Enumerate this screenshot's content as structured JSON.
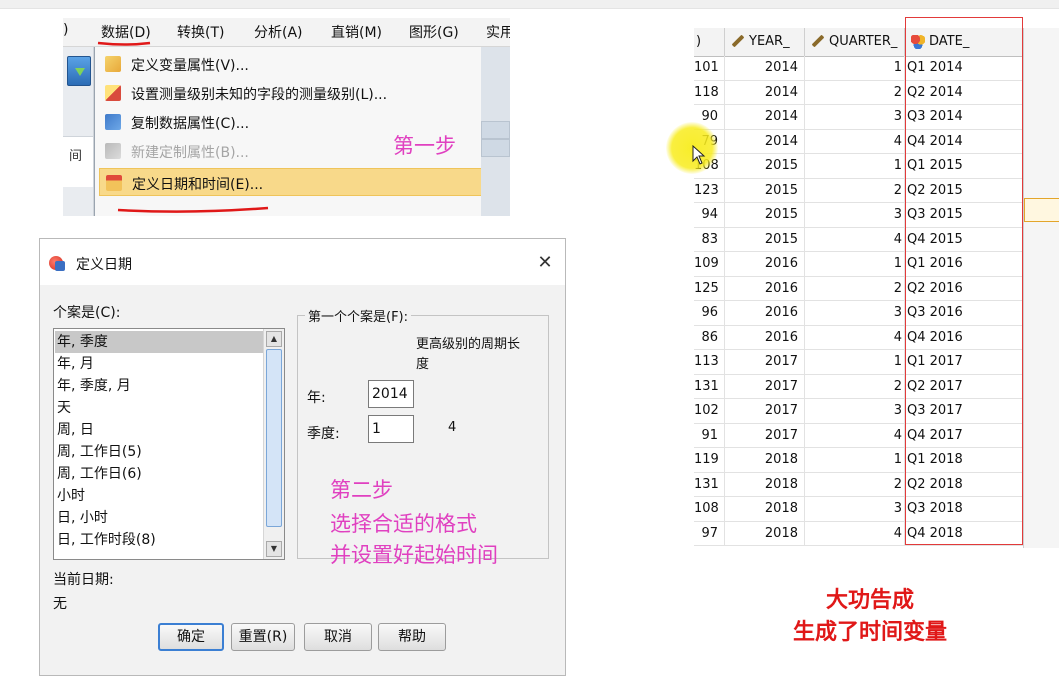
{
  "menu": {
    "items": [
      {
        "label": ")"
      },
      {
        "label": "数据(D)"
      },
      {
        "label": "转换(T)"
      },
      {
        "label": "分析(A)"
      },
      {
        "label": "直销(M)"
      },
      {
        "label": "图形(G)"
      },
      {
        "label": "实用"
      }
    ],
    "side_label": "间",
    "dropdown": [
      {
        "label": "定义变量属性(V)...",
        "icon": "define-variable-properties-icon"
      },
      {
        "label": "设置测量级别未知的字段的测量级别(L)...",
        "icon": "set-measurement-level-icon"
      },
      {
        "label": "复制数据属性(C)...",
        "icon": "copy-data-properties-icon"
      },
      {
        "label": "新建定制属性(B)...",
        "icon": "new-custom-attribute-icon"
      },
      {
        "label": "定义日期和时间(E)...",
        "icon": "define-dates-icon"
      }
    ]
  },
  "annotations": {
    "step1": "第一步",
    "step2_line1": "第二步",
    "step2_line2": "选择合适的格式",
    "step2_line3": "并设置好起始时间",
    "done_line1": "大功告成",
    "done_line2": "生成了时间变量"
  },
  "dialog": {
    "title": "定义日期",
    "close": "✕",
    "cases_label": "个案是(C):",
    "cases": [
      "年, 季度",
      "年, 月",
      "年, 季度, 月",
      "天",
      "周, 日",
      "周, 工作日(5)",
      "周, 工作日(6)",
      "小时",
      "日, 小时",
      "日, 工作时段(8)"
    ],
    "selected_case_index": 0,
    "group_title": "第一个个案是(F):",
    "periodicity_header_line1": "更高级别的周期长",
    "periodicity_header_line2": "度",
    "year_label": "年:",
    "year_value": "2014",
    "quarter_label": "季度:",
    "quarter_value": "1",
    "quarter_period": "4",
    "current_dates_label": "当前日期:",
    "current_dates_value": "无",
    "buttons": {
      "ok": "确定",
      "reset": "重置(R)",
      "cancel": "取消",
      "help": "帮助"
    }
  },
  "table": {
    "headers": {
      "first": ")",
      "year": "YEAR_",
      "quarter": "QUARTER_",
      "date": "DATE_"
    },
    "rows": [
      {
        "v": "101",
        "year": "2014",
        "q": "1",
        "date": "Q1 2014"
      },
      {
        "v": "118",
        "year": "2014",
        "q": "2",
        "date": "Q2 2014"
      },
      {
        "v": "90",
        "year": "2014",
        "q": "3",
        "date": "Q3 2014"
      },
      {
        "v": "79",
        "year": "2014",
        "q": "4",
        "date": "Q4 2014"
      },
      {
        "v": "108",
        "year": "2015",
        "q": "1",
        "date": "Q1 2015"
      },
      {
        "v": "123",
        "year": "2015",
        "q": "2",
        "date": "Q2 2015"
      },
      {
        "v": "94",
        "year": "2015",
        "q": "3",
        "date": "Q3 2015"
      },
      {
        "v": "83",
        "year": "2015",
        "q": "4",
        "date": "Q4 2015"
      },
      {
        "v": "109",
        "year": "2016",
        "q": "1",
        "date": "Q1 2016"
      },
      {
        "v": "125",
        "year": "2016",
        "q": "2",
        "date": "Q2 2016"
      },
      {
        "v": "96",
        "year": "2016",
        "q": "3",
        "date": "Q3 2016"
      },
      {
        "v": "86",
        "year": "2016",
        "q": "4",
        "date": "Q4 2016"
      },
      {
        "v": "113",
        "year": "2017",
        "q": "1",
        "date": "Q1 2017"
      },
      {
        "v": "131",
        "year": "2017",
        "q": "2",
        "date": "Q2 2017"
      },
      {
        "v": "102",
        "year": "2017",
        "q": "3",
        "date": "Q3 2017"
      },
      {
        "v": "91",
        "year": "2017",
        "q": "4",
        "date": "Q4 2017"
      },
      {
        "v": "119",
        "year": "2018",
        "q": "1",
        "date": "Q1 2018"
      },
      {
        "v": "131",
        "year": "2018",
        "q": "2",
        "date": "Q2 2018"
      },
      {
        "v": "108",
        "year": "2018",
        "q": "3",
        "date": "Q3 2018"
      },
      {
        "v": "97",
        "year": "2018",
        "q": "4",
        "date": "Q4 2018"
      }
    ]
  },
  "colors": {
    "annotation_red": "#e01818",
    "annotation_pink": "#e040c0",
    "menu_highlight": "#f8d98a",
    "cursor_glow": "#f8ec1e"
  }
}
